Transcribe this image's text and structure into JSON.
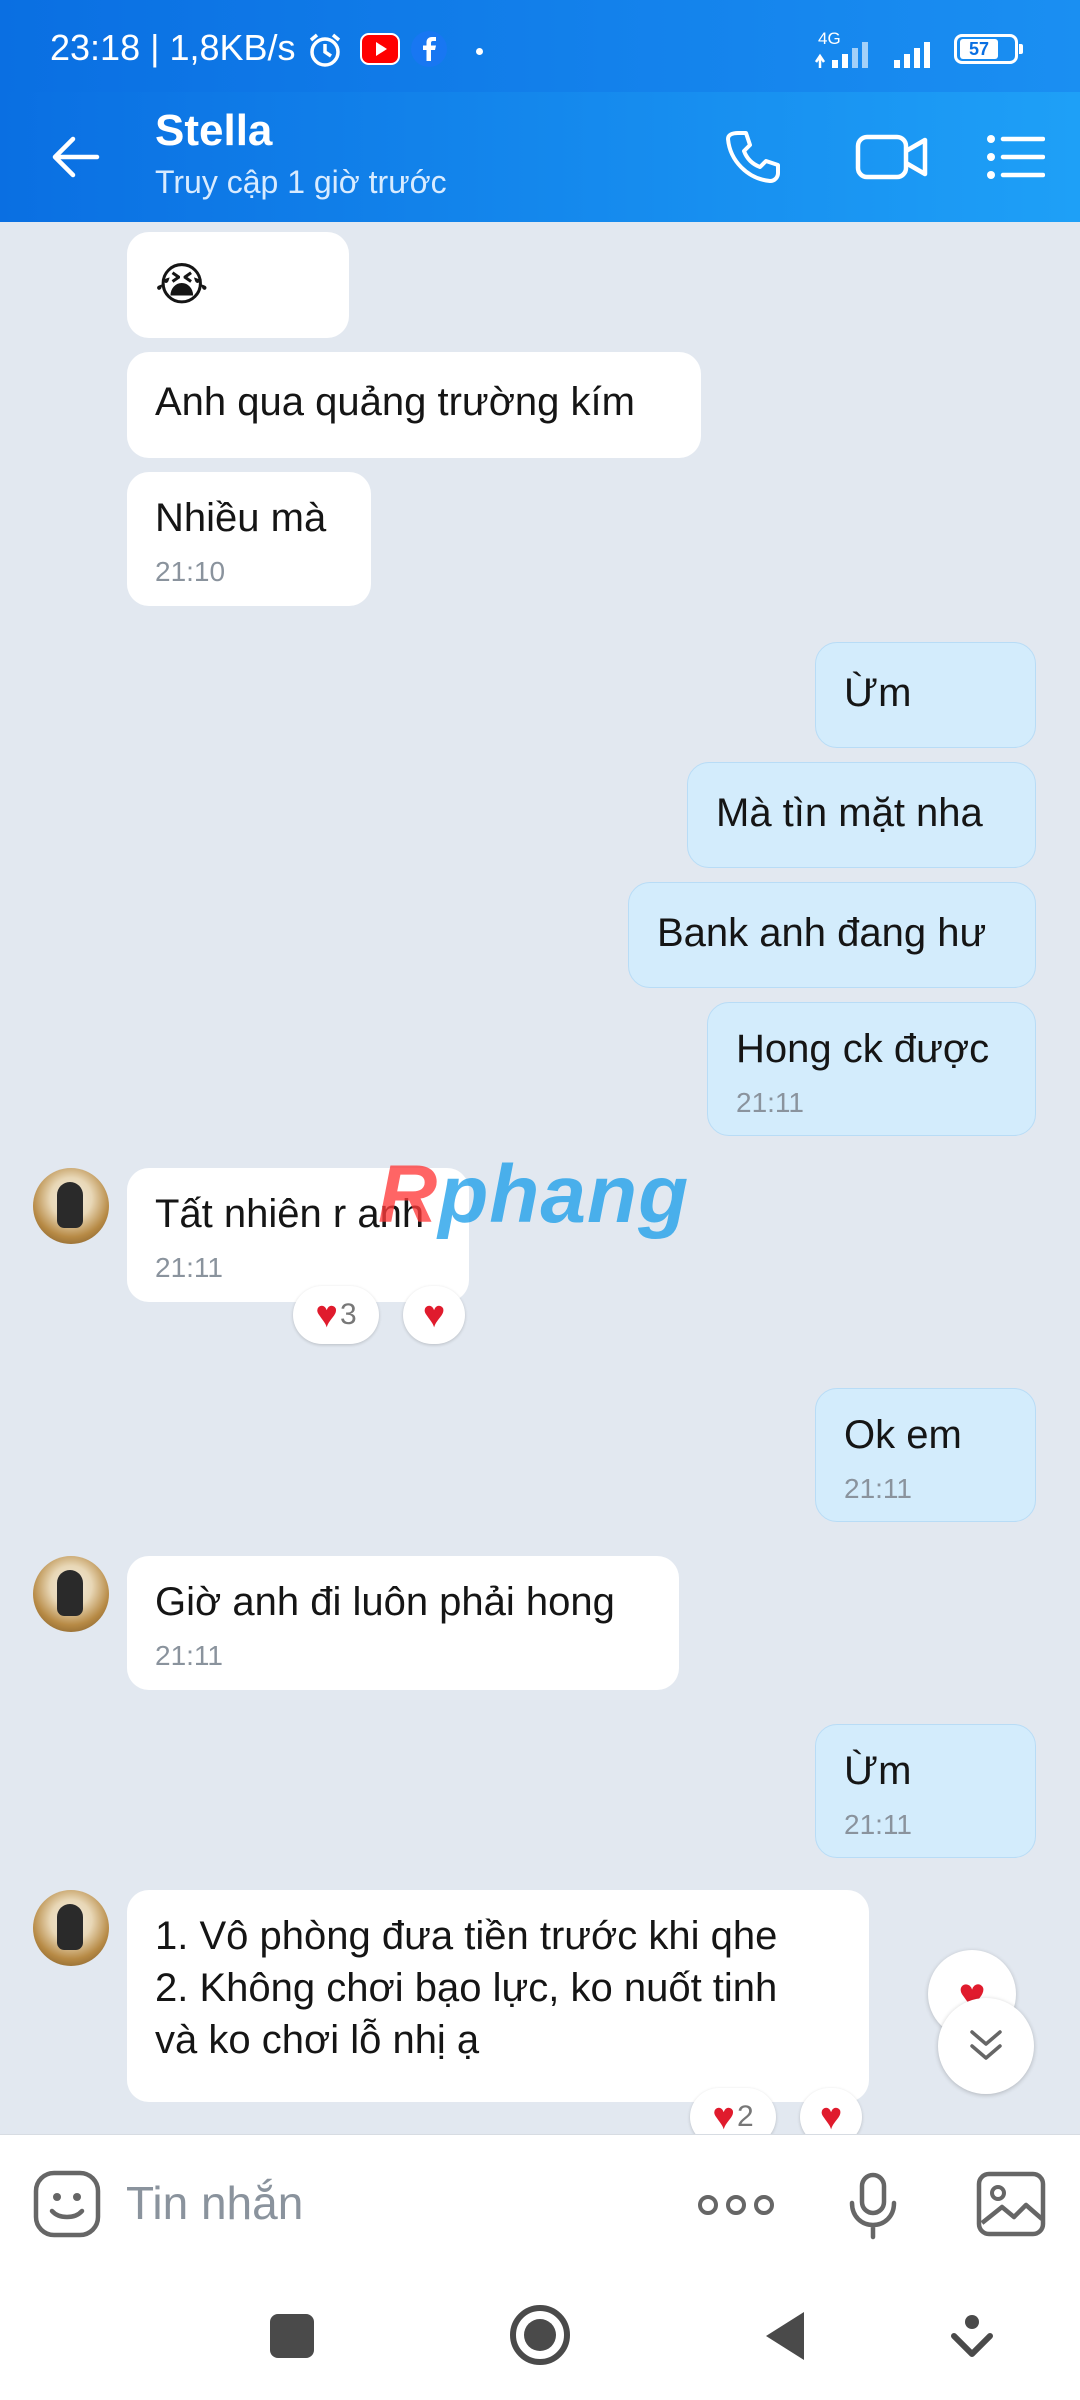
{
  "status_bar": {
    "time": "23:18 | 1,8KB/s",
    "network_label": "4G",
    "battery": "57"
  },
  "header": {
    "contact_name": "Stella",
    "contact_status": "Truy cập 1 giờ trước"
  },
  "messages": [
    {
      "dir": "in",
      "text": "😭",
      "time": ""
    },
    {
      "dir": "in",
      "text": "Anh qua quảng trường kím",
      "time": ""
    },
    {
      "dir": "in",
      "text": "Nhiều mà",
      "time": "21:10"
    },
    {
      "dir": "out",
      "text": "Ừm",
      "time": ""
    },
    {
      "dir": "out",
      "text": "Mà tìn mặt nha",
      "time": ""
    },
    {
      "dir": "out",
      "text": "Bank anh đang hư",
      "time": ""
    },
    {
      "dir": "out",
      "text": "Hong ck được",
      "time": "21:11"
    },
    {
      "dir": "in",
      "text": "Tất nhiên r anh",
      "time": "21:11",
      "reaction_count": "3"
    },
    {
      "dir": "out",
      "text": "Ok em",
      "time": "21:11"
    },
    {
      "dir": "in",
      "text": "Giờ anh đi luôn phải hong",
      "time": "21:11"
    },
    {
      "dir": "out",
      "text": "Ừm",
      "time": "21:11"
    },
    {
      "dir": "in",
      "text": "1. Vô phòng đưa tiền trước khi qhe\n2. Không chơi bạo lực, ko nuốt tinh\nvà ko chơi lỗ nhị ạ",
      "time": "",
      "reaction_count": "2"
    }
  ],
  "watermark": {
    "first": "R",
    "rest": "phang"
  },
  "input": {
    "placeholder": "Tin nhắn"
  },
  "colors": {
    "header_blue": "#0a6fe2",
    "outgoing_bubble": "#d3ecfc",
    "incoming_bubble": "#ffffff",
    "background": "#e2e8f0",
    "heart": "#e01b2d"
  },
  "icons": [
    "back-arrow-icon",
    "phone-icon",
    "video-call-icon",
    "menu-list-icon",
    "sticker-icon",
    "more-dots-icon",
    "microphone-icon",
    "image-icon",
    "chevron-double-down-icon",
    "heart-icon"
  ]
}
